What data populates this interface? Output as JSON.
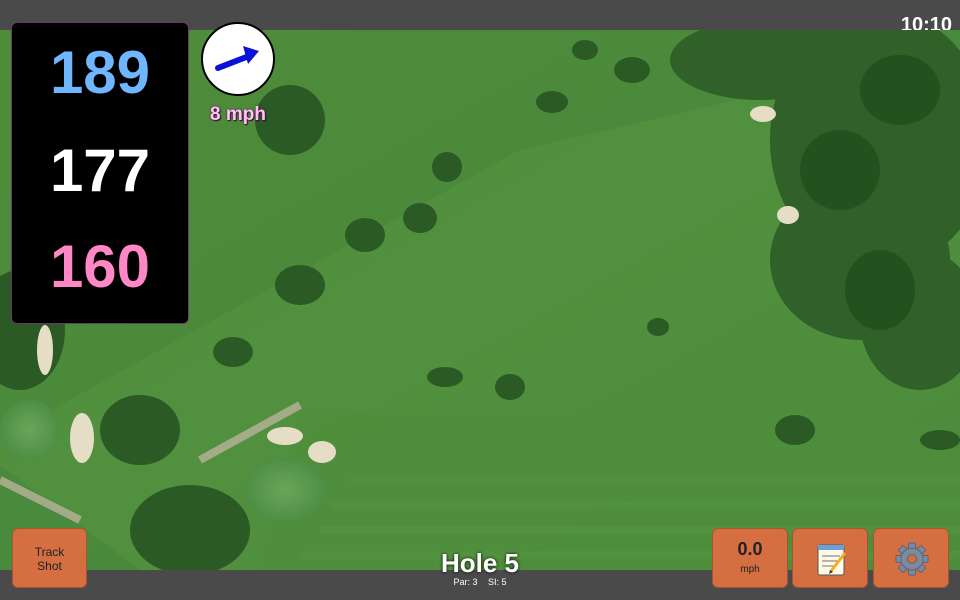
{
  "status_bar": {
    "time": "10:10"
  },
  "distances": {
    "back": "189",
    "middle": "177",
    "front": "160"
  },
  "wind": {
    "speed": "8 mph",
    "icon": "arrow-right-up-icon"
  },
  "hole": {
    "title": "Hole 5",
    "par": "Par: 3",
    "stroke_index": "SI: 5"
  },
  "buttons": {
    "track_shot": "Track\nShot",
    "speed_value": "0.0",
    "speed_unit": "mph",
    "notes_icon": "notepad-icon",
    "settings_icon": "gear-icon"
  },
  "colors": {
    "back_distance": "#6fb6ff",
    "middle_distance": "#ffffff",
    "front_distance": "#ff87c6",
    "button_bg": "#d56f42",
    "fairway": "#4e8f3a"
  }
}
